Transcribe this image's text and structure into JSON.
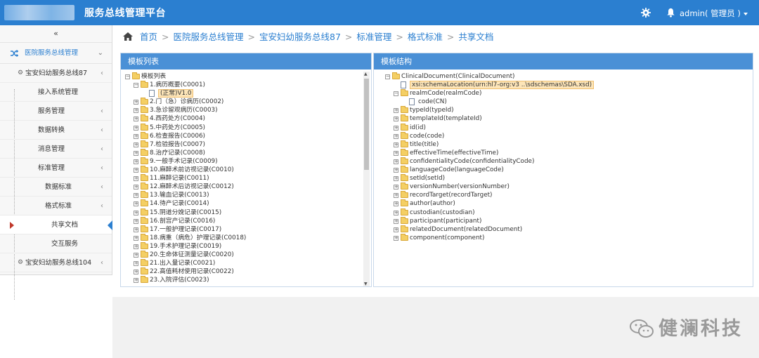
{
  "header": {
    "title": "服务总线管理平台",
    "user": "admin( 管理员 )"
  },
  "sidebar": {
    "collapse": "«",
    "top": "医院服务总线管理",
    "items": [
      {
        "label": "宝安妇幼服务总线87",
        "indent": 36
      },
      {
        "label": "接入系统管理",
        "indent": 54
      },
      {
        "label": "服务管理",
        "indent": 54
      },
      {
        "label": "数据转换",
        "indent": 54
      },
      {
        "label": "消息管理",
        "indent": 54
      },
      {
        "label": "标准管理",
        "indent": 54
      },
      {
        "label": "数据标准",
        "indent": 64
      },
      {
        "label": "格式标准",
        "indent": 64
      },
      {
        "label": "共享文档",
        "indent": 73
      },
      {
        "label": "交互服务",
        "indent": 73
      },
      {
        "label": "宝安妇幼服务总线104",
        "indent": 36
      }
    ]
  },
  "breadcrumb": [
    "首页",
    "医院服务总线管理",
    "宝安妇幼服务总线87",
    "标准管理",
    "格式标准",
    "共享文档"
  ],
  "left_panel": {
    "title": "模板列表",
    "root": "模板列表",
    "first": "1.病历概要(C0001)",
    "first_child": "(正常)V1.0",
    "items": [
      "2.门（急）诊病历(C0002)",
      "3.急诊留观病历(C0003)",
      "4.西药处方(C0004)",
      "5.中药处方(C0005)",
      "6.检查报告(C0006)",
      "7.检验报告(C0007)",
      "8.治疗记录(C0008)",
      "9.一般手术记录(C0009)",
      "10.麻醉术前访视记录(C0010)",
      "11.麻醉记录(C0011)",
      "12.麻醉术后访视记录(C0012)",
      "13.输血记录(C0013)",
      "14.待产记录(C0014)",
      "15.阴道分娩记录(C0015)",
      "16.剖宫产记录(C0016)",
      "17.一般护理记录(C0017)",
      "18.病重（病危）护理记录(C0018)",
      "19.手术护理记录(C0019)",
      "20.生命体征测量记录(C0020)",
      "21.出入量记录(C0021)",
      "22.高值耗材使用记录(C0022)",
      "23.入院评估(C0023)"
    ]
  },
  "right_panel": {
    "title": "模板结构",
    "root": "ClinicalDocument(ClinicalDocument)",
    "schema": "xsi:schemaLocation(urn:hl7-org:v3 ..\\sdschemas\\SDA.xsd)",
    "realm": "realmCode(realmCode)",
    "realm_child": "code(CN)",
    "items": [
      "typeId(typeId)",
      "templateId(templateId)",
      "id(id)",
      "code(code)",
      "title(title)",
      "effectiveTime(effectiveTime)",
      "confidentialityCode(confidentialityCode)",
      "languageCode(languageCode)",
      "setId(setId)",
      "versionNumber(versionNumber)",
      "recordTarget(recordTarget)",
      "author(author)",
      "custodian(custodian)",
      "participant(participant)",
      "relatedDocument(relatedDocument)",
      "component(component)"
    ]
  },
  "watermark": "健澜科技"
}
